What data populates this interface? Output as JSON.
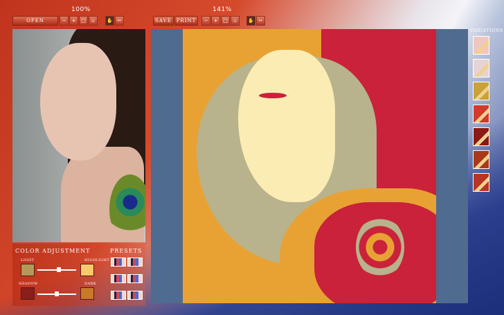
{
  "toolbar": {
    "left_zoom": "100%",
    "right_zoom": "141%",
    "open_label": "OPEN",
    "save_label": "SAVE",
    "print_label": "PRINT"
  },
  "color_adjustment": {
    "title": "COLOR ADJUSTMENT",
    "light_label": "LIGHT",
    "highlight_label": "HIGHLIGHT",
    "shadow_label": "SHADOW",
    "dark_label": "DARK",
    "light_color": "#b39a5a",
    "highlight_color": "#f7c96a",
    "shadow_color": "#8a1e1a",
    "dark_color": "#c87a2a",
    "slider1_value": 0.55,
    "slider2_value": 0.5
  },
  "presets": {
    "title": "PRESETS"
  },
  "variations": {
    "title": "VARIATIONS",
    "thumbs": [
      {
        "color": "#f0c7c0"
      },
      {
        "color": "#e6d4d4"
      },
      {
        "color": "#c9a23a"
      },
      {
        "color": "#d23a2a"
      },
      {
        "color": "#8a1a14"
      },
      {
        "color": "#a83a1a"
      },
      {
        "color": "#b83424"
      }
    ]
  },
  "palette": {
    "art_red": "#c9223a",
    "art_orange": "#e8a234",
    "art_khaki": "#b8b38c",
    "art_cream": "#fbecb4",
    "canvas_bg": "#4f6b8f"
  }
}
